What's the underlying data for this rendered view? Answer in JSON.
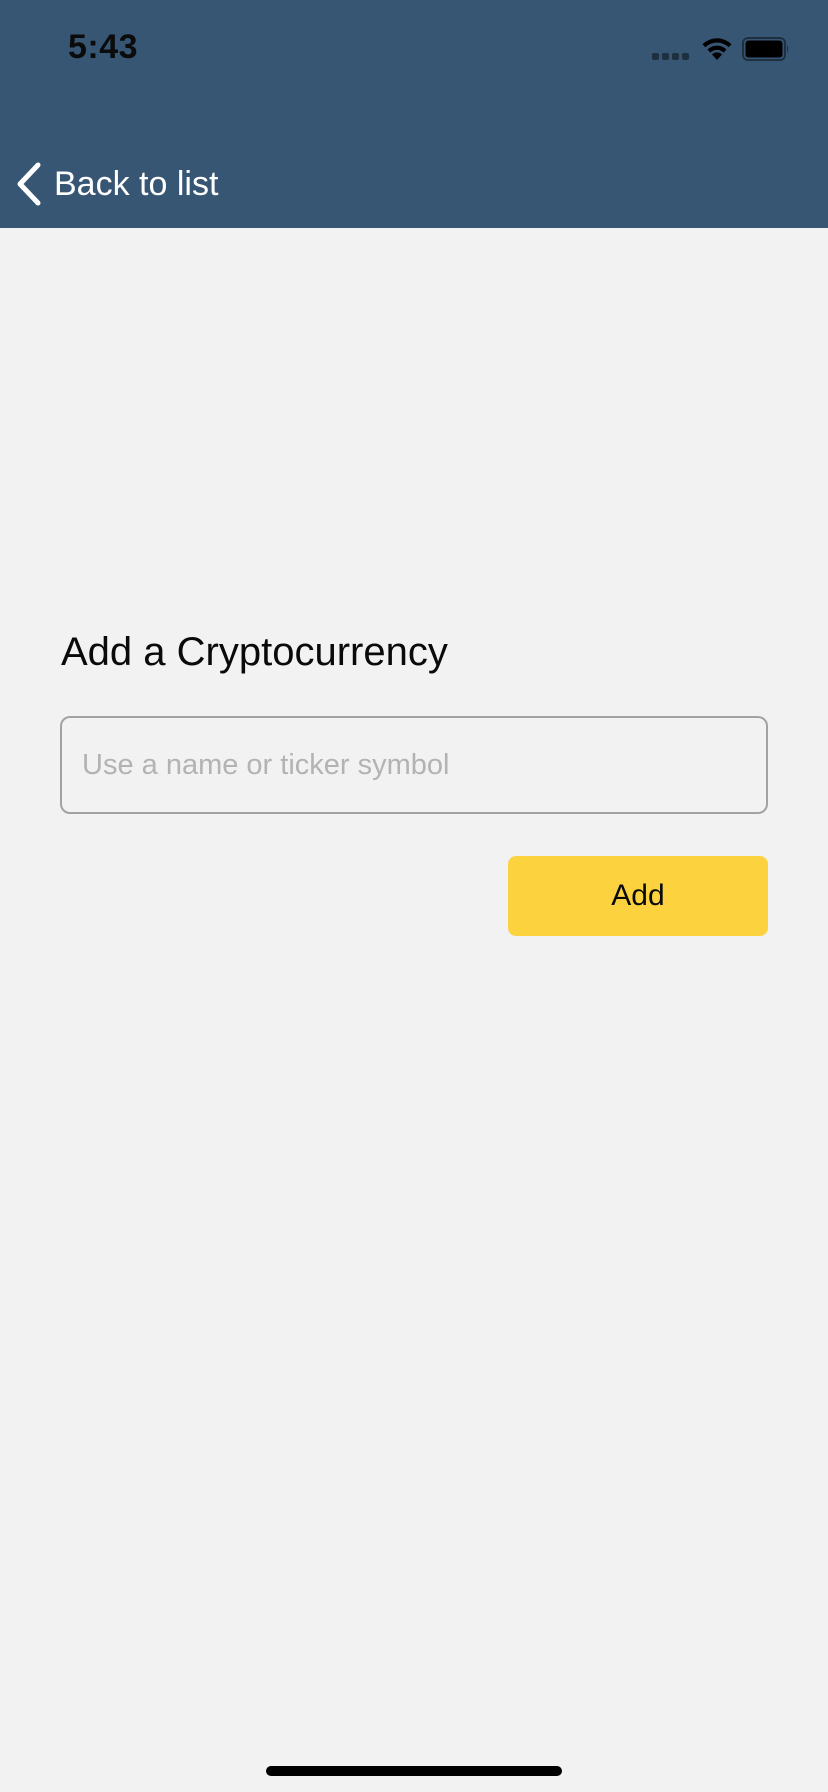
{
  "status_bar": {
    "time": "5:43"
  },
  "nav": {
    "back_label": "Back to list"
  },
  "main": {
    "title": "Add a Cryptocurrency",
    "search_placeholder": "Use a name or ticker symbol",
    "search_value": "",
    "add_label": "Add"
  },
  "colors": {
    "header_background": "#375674",
    "page_background": "#f2f2f2",
    "accent_button": "#fcd33f"
  },
  "icons": [
    "cellular-signal-icon",
    "wifi-icon",
    "battery-icon",
    "chevron-left-icon"
  ]
}
